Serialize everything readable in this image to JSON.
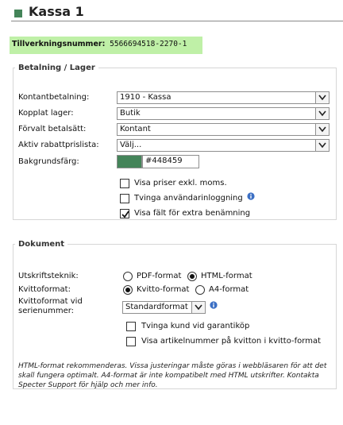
{
  "page": {
    "title": "Kassa 1",
    "accent_color": "#448459",
    "serial_label": "Tillverkningsnummer:",
    "serial_value": "5566694518-2270-1"
  },
  "payment": {
    "legend": "Betalning / Lager",
    "fields": {
      "cash_payment": {
        "label": "Kontantbetalning:",
        "value": "1910 - Kassa"
      },
      "linked_stock": {
        "label": "Kopplat lager:",
        "value": "Butik"
      },
      "default_method": {
        "label": "Förvalt betalsätt:",
        "value": "Kontant"
      },
      "discount_list": {
        "label": "Aktiv rabattprislista:",
        "value": "Välj..."
      },
      "background_color": {
        "label": "Bakgrundsfärg:",
        "value": "#448459",
        "swatch": "#448459"
      }
    },
    "checks": [
      {
        "label": "Visa priser exkl. moms.",
        "checked": false
      },
      {
        "label": "Tvinga användarinloggning",
        "checked": false,
        "info_icon": "info-icon"
      },
      {
        "label": "Visa fält för extra benämning",
        "checked": true
      }
    ]
  },
  "document": {
    "legend": "Dokument",
    "print_tech": {
      "label": "Utskriftsteknik:",
      "options": [
        {
          "label": "PDF-format",
          "selected": false
        },
        {
          "label": "HTML-format",
          "selected": true
        }
      ]
    },
    "receipt_format": {
      "label": "Kvittoformat:",
      "options": [
        {
          "label": "Kvitto-format",
          "selected": true
        },
        {
          "label": "A4-format",
          "selected": false
        }
      ]
    },
    "serial_receipt": {
      "label_line1": "Kvittoformat vid",
      "label_line2": "serienummer:",
      "value": "Standardformat",
      "info_icon": "info-icon"
    },
    "checks": [
      {
        "label": "Tvinga kund vid garantiköp",
        "checked": false
      },
      {
        "label": "Visa artikelnummer på kvitton i kvitto-format",
        "checked": false
      }
    ],
    "note": "HTML-format rekommenderas. Vissa justeringar måste göras i webbläsaren för att det skall fungera optimalt. A4-format är inte kompatibelt med HTML utskrifter. Kontakta Specter Support för hjälp och mer info."
  }
}
